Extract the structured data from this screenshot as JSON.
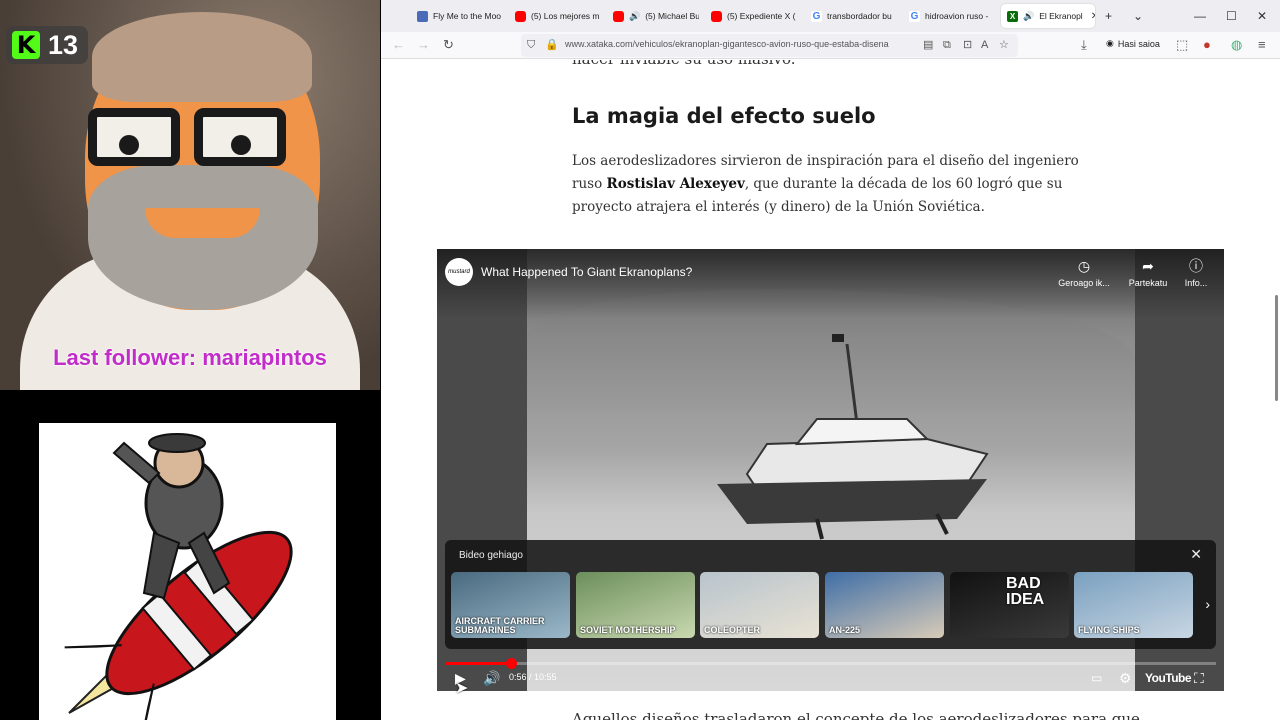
{
  "overlay": {
    "kick_count": "13",
    "kick_logo": "K",
    "last_follower": "Last follower: mariapintos"
  },
  "browser": {
    "tabs": [
      {
        "label": "Fly Me to the Moo",
        "icon": "music-icon"
      },
      {
        "label": "(5) Los mejores m",
        "icon": "youtube-icon"
      },
      {
        "label": "(5) Michael Bu",
        "icon": "youtube-icon",
        "audio": true
      },
      {
        "label": "(5) Expediente X (",
        "icon": "youtube-icon"
      },
      {
        "label": "transbordador bu",
        "icon": "google-icon"
      },
      {
        "label": "hidroavion ruso -",
        "icon": "google-icon"
      },
      {
        "label": "El Ekranopl",
        "icon": "xataka-icon",
        "audio": true,
        "active": true
      }
    ],
    "url": "www.xataka.com/vehiculos/ekranoplan-gigantesco-avion-ruso-que-estaba-disena",
    "signin_label": "Hasi saioa"
  },
  "article": {
    "cut_line": "hacer inviable su uso masivo.",
    "heading": "La magia del efecto suelo",
    "para_pre": "Los aerodeslizadores sirvieron de inspiración para el diseño del ingeniero ruso ",
    "para_bold": "Rostislav Alexeyev",
    "para_post": ", que durante la década de los 60 logró que su proyecto atrajera el interés (y dinero) de la Unión Soviética.",
    "next_para": "Aquellos diseños trasladaron el concepte de los aerodeslizadores para que"
  },
  "video": {
    "channel_logo": "mustard",
    "title": "What Happened To Giant Ekranoplans?",
    "watch_later": "Geroago ik...",
    "share": "Partekatu",
    "info": "Info...",
    "suggested_label": "Bideo gehiago",
    "suggestions": [
      {
        "caption": "AIRCRAFT CARRIER SUBMARINES",
        "color1": "#4a6a80",
        "color2": "#9ab8c8"
      },
      {
        "caption": "SOVIET MOTHERSHIP",
        "color1": "#6c8f5c",
        "color2": "#c9d8b0"
      },
      {
        "caption": "COLEOPTER",
        "color1": "#b8c4cc",
        "color2": "#e8e2d4"
      },
      {
        "caption": "AN-225",
        "color1": "#3f6ea6",
        "color2": "#d8cbb8"
      },
      {
        "caption": "BAD IDEA",
        "color1": "#111111",
        "color2": "#3a3a3a"
      },
      {
        "caption": "FLYING SHIPS",
        "color1": "#7aa0c0",
        "color2": "#c8d6e2"
      }
    ],
    "time_display": "0:56 / 10:55",
    "progress": 0.0855,
    "brand": "YouTube",
    "accent": "#ff0000"
  }
}
